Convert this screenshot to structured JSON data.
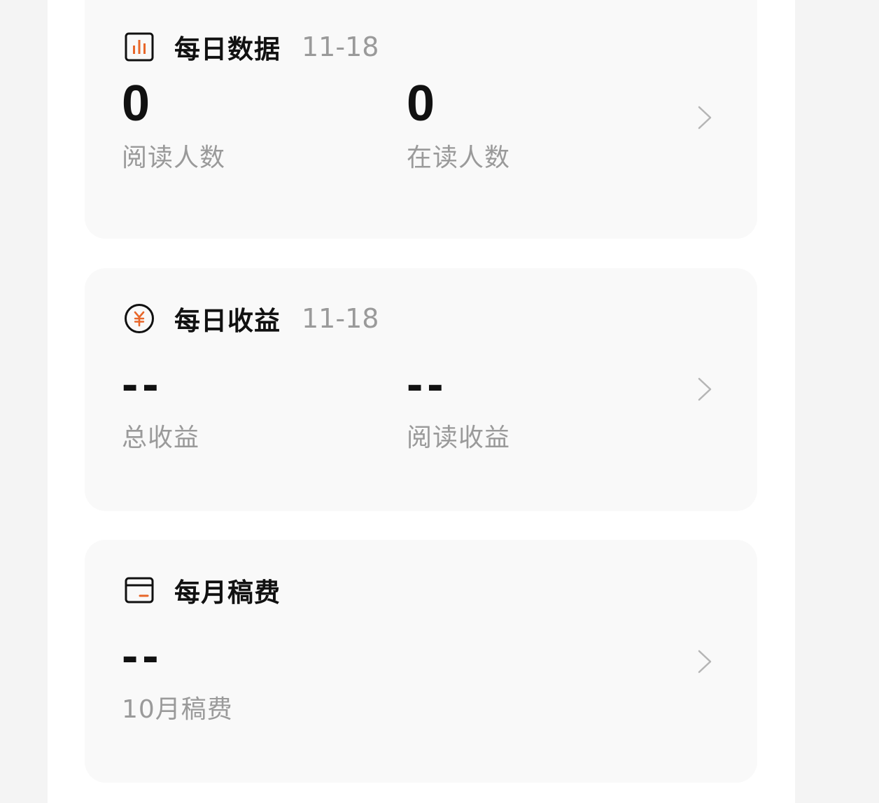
{
  "daily_data": {
    "title": "每日数据",
    "date": "11-18",
    "icon": "bar-chart-icon",
    "stats": [
      {
        "value": "0",
        "label": "阅读人数"
      },
      {
        "value": "0",
        "label": "在读人数"
      }
    ]
  },
  "daily_income": {
    "title": "每日收益",
    "date": "11-18",
    "icon": "yuan-coin-icon",
    "stats": [
      {
        "value": "--",
        "label": "总收益"
      },
      {
        "value": "--",
        "label": "阅读收益"
      }
    ]
  },
  "monthly_fee": {
    "title": "每月稿费",
    "icon": "wallet-card-icon",
    "stats": [
      {
        "value": "--",
        "label": "10月稿费"
      }
    ]
  },
  "colors": {
    "accent": "#e8672a",
    "text_primary": "#111111",
    "text_secondary": "#9a9a9a",
    "card_bg": "#f9f9f9"
  }
}
